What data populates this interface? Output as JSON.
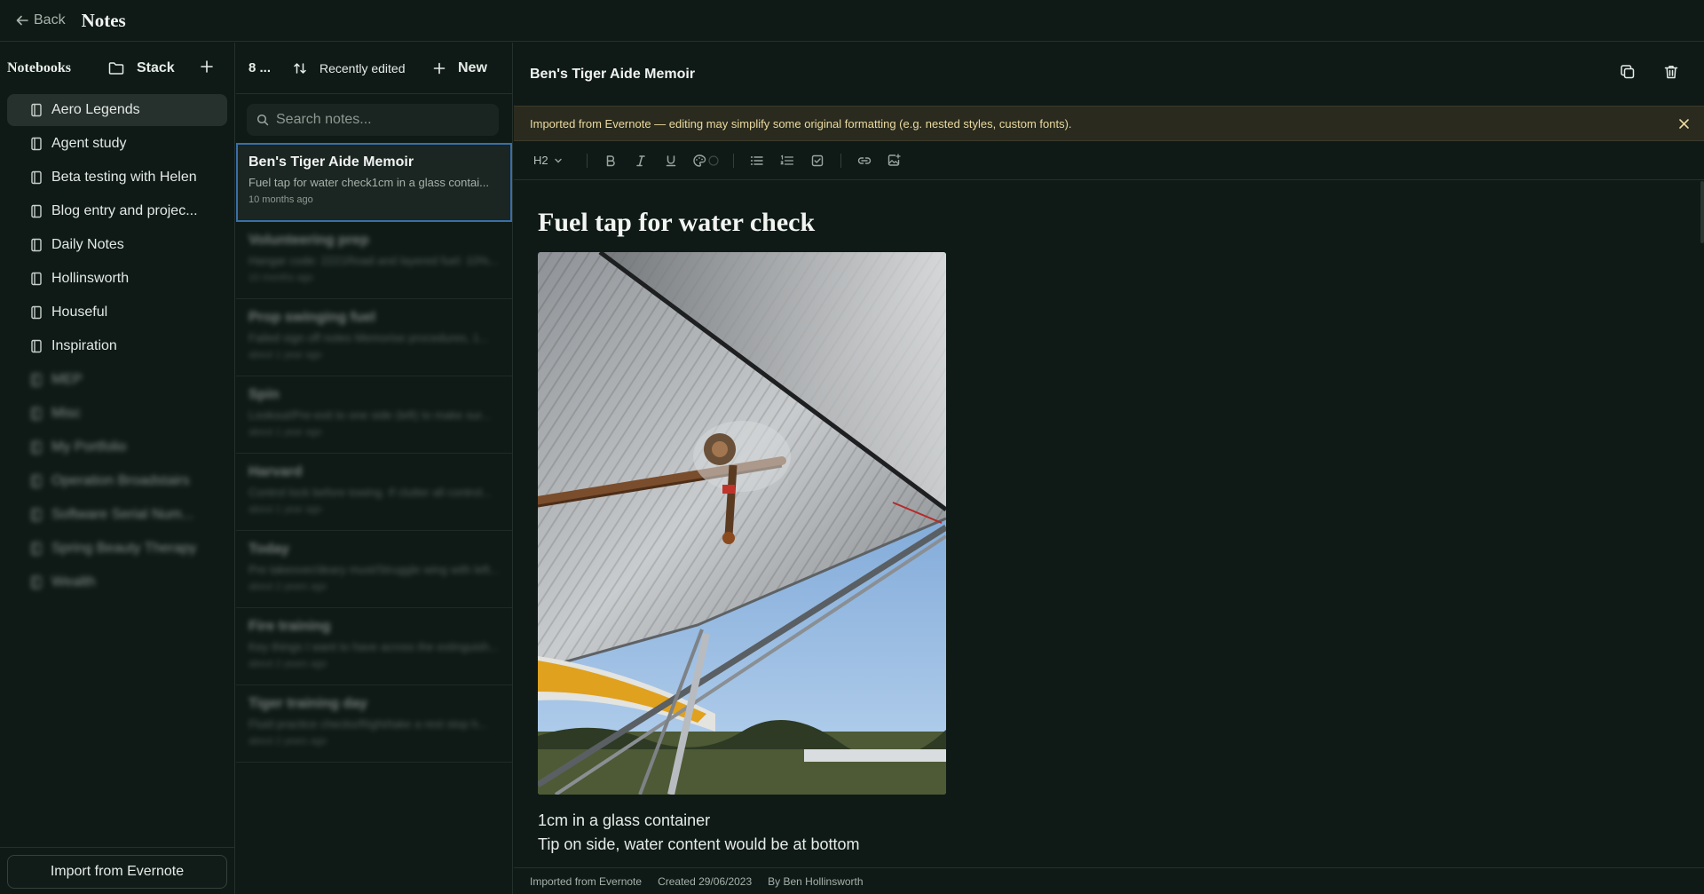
{
  "topbar": {
    "back_label": "Back",
    "title": "Notes"
  },
  "sidebar": {
    "title": "Notebooks",
    "stack_label": "Stack",
    "notebooks": [
      {
        "label": "Aero Legends",
        "active": true
      },
      {
        "label": "Agent study"
      },
      {
        "label": "Beta testing with Helen"
      },
      {
        "label": "Blog entry and projec..."
      },
      {
        "label": "Daily Notes"
      },
      {
        "label": "Hollinsworth"
      },
      {
        "label": "Houseful"
      },
      {
        "label": "Inspiration"
      },
      {
        "label": "MEP",
        "blurred": true
      },
      {
        "label": "Misc",
        "blurred": true
      },
      {
        "label": "My Portfolio",
        "blurred": true
      },
      {
        "label": "Operation Broadstairs",
        "blurred": true
      },
      {
        "label": "Software Serial Num...",
        "blurred": true
      },
      {
        "label": "Spring Beauty Therapy",
        "blurred": true
      },
      {
        "label": "Wealth",
        "blurred": true
      }
    ],
    "import_label": "Import from Evernote"
  },
  "notes_list": {
    "count_label": "8 ...",
    "sort_label": "Recently edited",
    "new_label": "New",
    "search_placeholder": "Search notes...",
    "notes": [
      {
        "title": "Ben's Tiger Aide Memoir",
        "snippet": "Fuel tap for water check1cm in a glass contai...",
        "date": "10 months ago",
        "selected": true
      },
      {
        "title": "Volunteering prep",
        "snippet": "Hangar code: 2221Road and layered fuel: 10%...",
        "date": "10 months ago",
        "blurred": true
      },
      {
        "title": "Prop swinging fuel",
        "snippet": "Failed sign off notes Memorise procedures, 1...",
        "date": "about 1 year ago",
        "blurred": true
      },
      {
        "title": "Spin",
        "snippet": "Lookout/Pre-exit to one side (left) to make sur...",
        "date": "about 1 year ago",
        "blurred": true
      },
      {
        "title": "Harvard",
        "snippet": "Control lock before towing. If clutter all control...",
        "date": "about 1 year ago",
        "blurred": true
      },
      {
        "title": "Today",
        "snippet": "Pre takeover/deary must/Struggle wing with left...",
        "date": "about 2 years ago",
        "blurred": true
      },
      {
        "title": "Fire training",
        "snippet": "Key things I want to have across the extinguish...",
        "date": "about 2 years ago",
        "blurred": true
      },
      {
        "title": "Tiger training day",
        "snippet": "Fluid practice checks/Right/take a rest stop h...",
        "date": "about 2 years ago",
        "blurred": true
      }
    ]
  },
  "editor": {
    "header_title": "Ben's Tiger Aide Memoir",
    "banner_text": "Imported from Evernote — editing may simplify some original formatting (e.g. nested styles, custom fonts).",
    "heading_select": "H2",
    "content_heading": "Fuel tap for water check",
    "body_lines": [
      "1cm in a glass container",
      "Tip on side, water content would be at bottom"
    ],
    "footer": {
      "source": "Imported from Evernote",
      "created": "Created 29/06/2023",
      "author": "By Ben Hollinsworth"
    }
  },
  "colors": {
    "background": "#0f1a16",
    "banner_bg": "#2a2b1e",
    "banner_text": "#ead9a0",
    "selection_border": "#3a6ea8"
  }
}
